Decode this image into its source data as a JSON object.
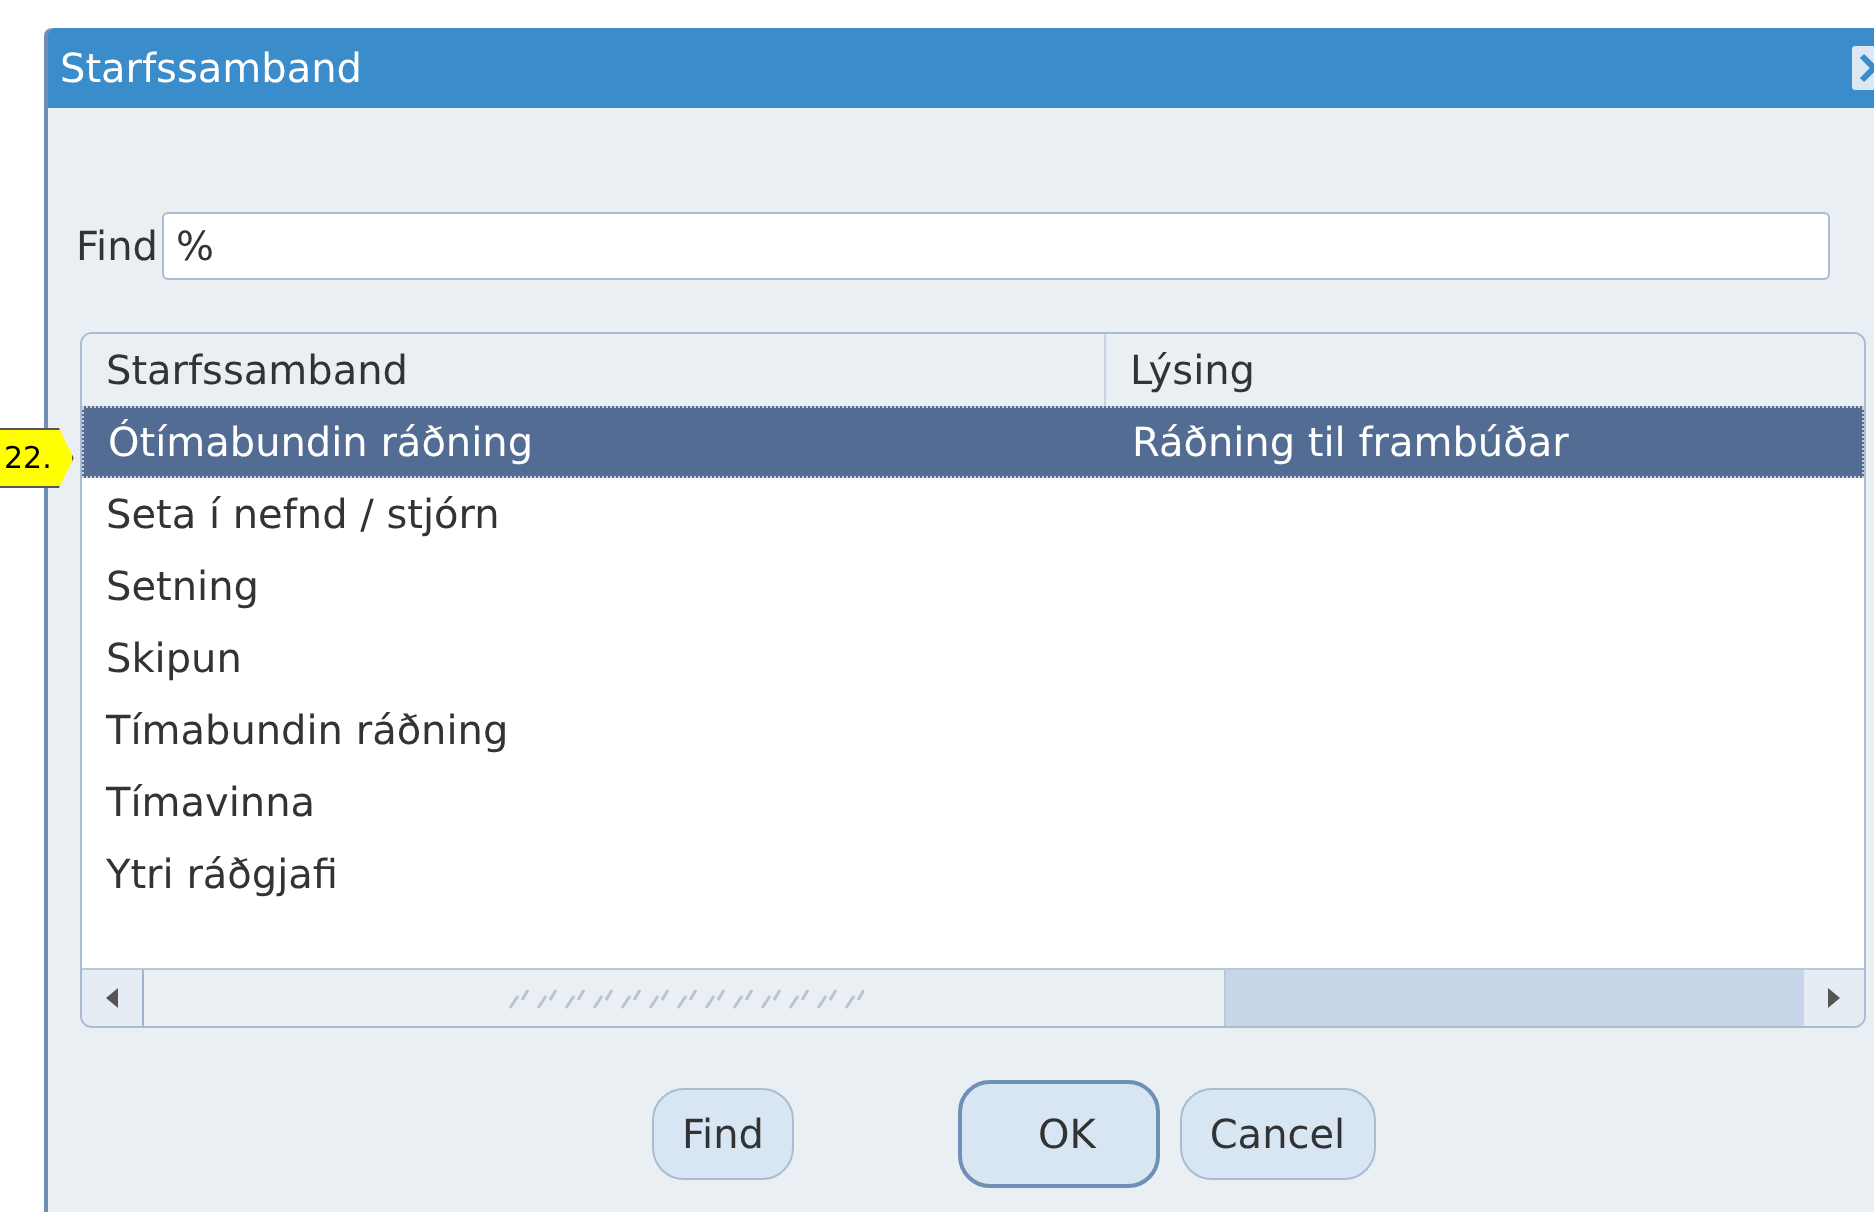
{
  "window": {
    "title": "Starfssamband"
  },
  "find": {
    "label": "Find",
    "value": "%"
  },
  "table": {
    "columns": [
      "Starfssamband",
      "Lýsing"
    ],
    "rows": [
      {
        "cells": [
          "Ótímabundin ráðning",
          "Ráðning til frambúðar"
        ],
        "selected": true
      },
      {
        "cells": [
          "Seta í nefnd / stjórn",
          ""
        ],
        "selected": false
      },
      {
        "cells": [
          "Setning",
          ""
        ],
        "selected": false
      },
      {
        "cells": [
          "Skipun",
          ""
        ],
        "selected": false
      },
      {
        "cells": [
          "Tímabundin ráðning",
          ""
        ],
        "selected": false
      },
      {
        "cells": [
          "Tímavinna",
          ""
        ],
        "selected": false
      },
      {
        "cells": [
          "Ytri ráðgjafi",
          ""
        ],
        "selected": false
      }
    ]
  },
  "callout": {
    "text": "22."
  },
  "buttons": [
    {
      "label": "Find",
      "default": false
    },
    {
      "label": "OK",
      "default": true
    },
    {
      "label": "Cancel",
      "default": false
    }
  ]
}
